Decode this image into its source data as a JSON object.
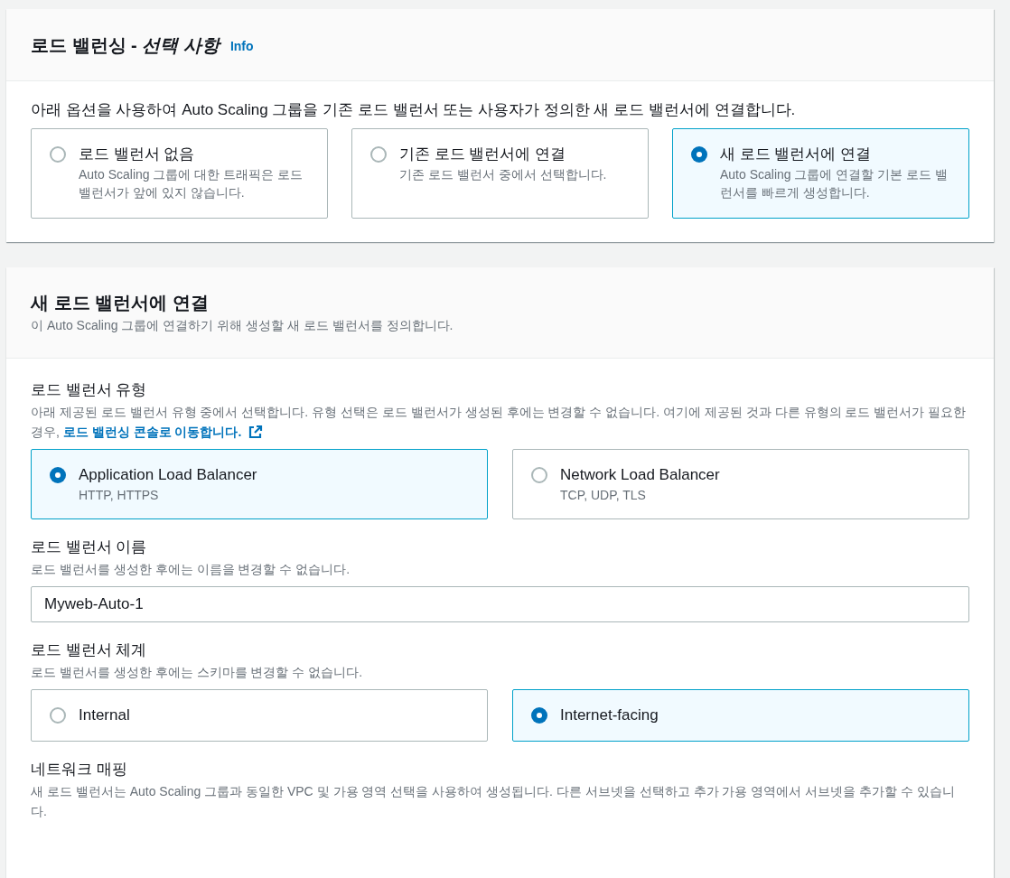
{
  "panels": [
    {
      "title": "로드 밸런싱 - *선택 사항*",
      "info_link": "Info",
      "description": "아래 옵션을 사용하여 Auto Scaling 그룹을 기존 로드 밸런서 또는 사용자가 정의한 새 로드 밸런서에 연결합니다.",
      "options": [
        {
          "label": "로드 밸런서 없음",
          "detail": "Auto Scaling 그룹에 대한 트래픽은 로드 밸런서가 앞에 있지 않습니다.",
          "selected": false
        },
        {
          "label": "기존 로드 밸런서에 연결",
          "detail": "기존 로드 밸런서 중에서 선택합니다.",
          "selected": false
        },
        {
          "label": "새 로드 밸런서에 연결",
          "detail": "Auto Scaling 그룹에 연결할 기본 로드 밸런서를 빠르게 생성합니다.",
          "selected": true
        }
      ]
    },
    {
      "title": "새 로드 밸런서에 연결",
      "subtitle": "이 Auto Scaling 그룹에 연결하기 위해 생성할 새 로드 밸런서를 정의합니다.",
      "fields": [
        {
          "kind": "radio",
          "label": "로드 밸런서 유형",
          "description": "아래 제공된 로드 밸런서 유형 중에서 선택합니다. 유형 선택은 로드 밸런서가 생성된 후에는 변경할 수 없습니다. 여기에 제공된 것과 다른 유형의 로드 밸런서가 필요한 경우,",
          "link": "로드 밸런싱 콘솔로 이동합니다.",
          "options": [
            {
              "label": "Application Load Balancer",
              "detail": "HTTP, HTTPS",
              "selected": true
            },
            {
              "label": "Network Load Balancer",
              "detail": "TCP, UDP, TLS",
              "selected": false
            }
          ]
        },
        {
          "kind": "text",
          "label": "로드 밸런서 이름",
          "description": "로드 밸런서를 생성한 후에는 이름을 변경할 수 없습니다.",
          "value": "Myweb-Auto-1"
        },
        {
          "kind": "radio",
          "label": "로드 밸런서 체계",
          "description": "로드 밸런서를 생성한 후에는 스키마를 변경할 수 없습니다.",
          "options": [
            {
              "label": "Internal",
              "selected": false
            },
            {
              "label": "Internet-facing",
              "selected": true
            }
          ]
        },
        {
          "kind": "info",
          "label": "네트워크 매핑",
          "description": "새 로드 밸런서는 Auto Scaling 그룹과 동일한 VPC 및 가용 영역 선택을 사용하여 생성됩니다. 다른 서브넷을 선택하고 추가 가용 영역에서 서브넷을 추가할 수 있습니다."
        }
      ]
    }
  ]
}
